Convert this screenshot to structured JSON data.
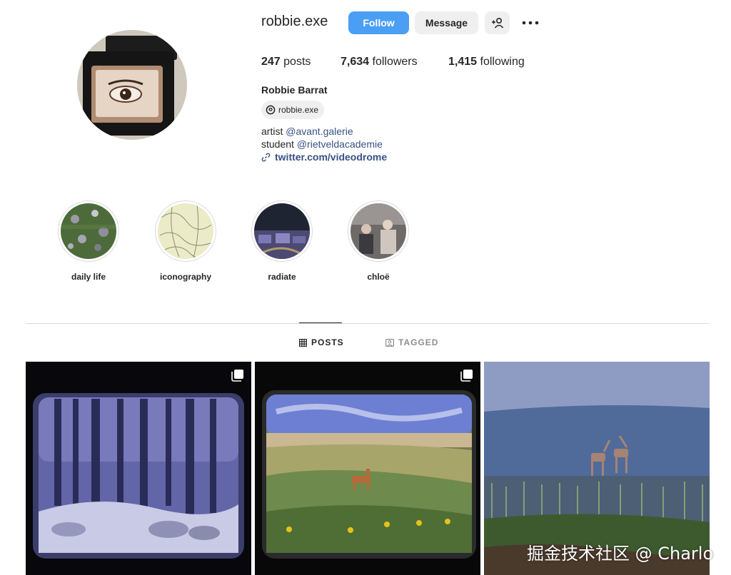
{
  "profile": {
    "username": "robbie.exe",
    "follow_label": "Follow",
    "message_label": "Message",
    "stats": [
      {
        "count": "247",
        "label": "posts"
      },
      {
        "count": "7,634",
        "label": "followers"
      },
      {
        "count": "1,415",
        "label": "following"
      }
    ],
    "full_name": "Robbie Barrat",
    "threads_handle": "robbie.exe",
    "bio": [
      {
        "prefix": "artist",
        "mention": "@avant.galerie"
      },
      {
        "prefix": "student",
        "mention": "@rietveldacademie"
      }
    ],
    "link": "twitter.com/videodrome"
  },
  "highlights": [
    {
      "label": "daily life",
      "icon": "highlight-thumbnail"
    },
    {
      "label": "iconography",
      "icon": "highlight-thumbnail"
    },
    {
      "label": "radiate",
      "icon": "highlight-thumbnail"
    },
    {
      "label": "chloë",
      "icon": "highlight-thumbnail"
    }
  ],
  "tabs": [
    {
      "label": "POSTS",
      "icon": "grid-icon",
      "active": true
    },
    {
      "label": "TAGGED",
      "icon": "tagged-icon",
      "active": false
    }
  ],
  "posts": [
    {
      "icon": "multiple-posts-icon"
    },
    {
      "icon": "multiple-posts-icon"
    },
    {
      "icon": ""
    }
  ],
  "watermark": "掘金技术社区 @ Charlo",
  "colors": {
    "accent": "#4a9ff5",
    "link": "#385185",
    "border": "#dbdbdb"
  }
}
